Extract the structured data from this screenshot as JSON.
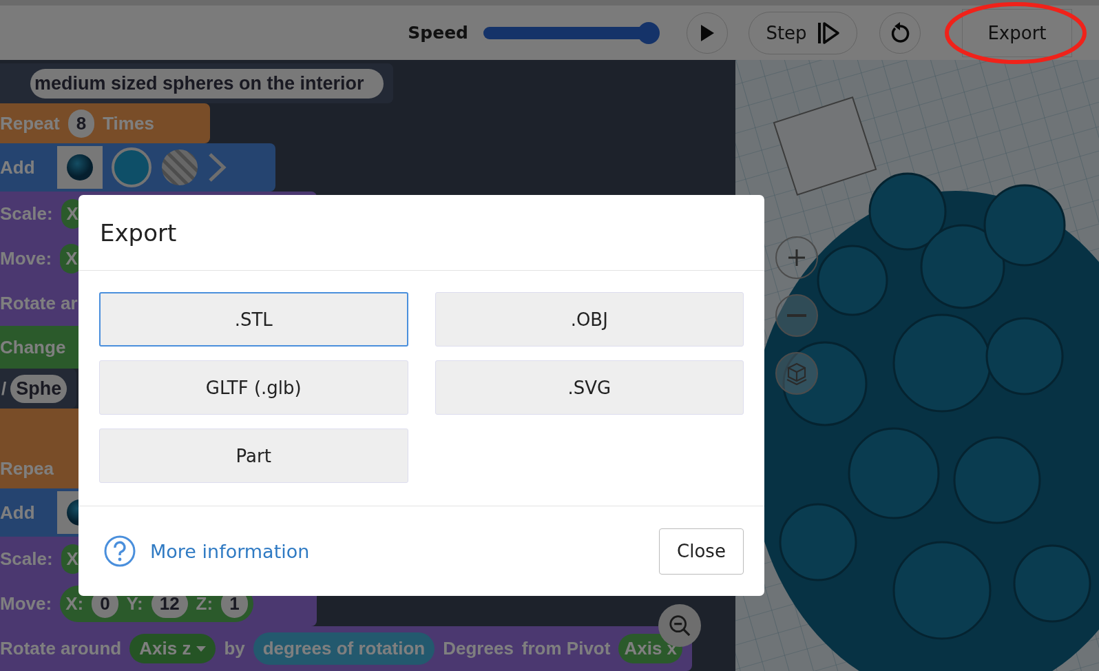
{
  "toolbar": {
    "speed_label": "Speed",
    "speed": {
      "level": 0.94
    },
    "buttons": [
      {
        "kind": "play"
      },
      {
        "kind": "step",
        "label": "Step"
      },
      {
        "kind": "reset"
      },
      {
        "kind": "export",
        "label": "Export",
        "highlighted": true
      }
    ]
  },
  "workspace": {
    "rows": [
      {
        "kind": "comment",
        "items": [
          {
            "kind": "pill",
            "text": "medium sized spheres on the interior"
          }
        ]
      },
      {
        "kind": "control",
        "items": [
          {
            "kind": "label",
            "text": "Repeat"
          },
          {
            "kind": "pill",
            "text": "8"
          },
          {
            "kind": "label",
            "text": "Times"
          }
        ]
      },
      {
        "kind": "shape",
        "items": [
          {
            "kind": "label",
            "text": "Add"
          },
          {
            "kind": "thumbnail"
          },
          {
            "kind": "color-swatch"
          },
          {
            "kind": "pattern-swatch"
          },
          {
            "kind": "chevron"
          }
        ]
      },
      {
        "kind": "transform",
        "items": [
          {
            "kind": "label",
            "text": "Scale:"
          },
          {
            "kind": "group",
            "items": [
              {
                "kind": "label",
                "text": "X"
              }
            ]
          }
        ]
      },
      {
        "kind": "transform",
        "items": [
          {
            "kind": "label",
            "text": "Move:"
          },
          {
            "kind": "group",
            "items": [
              {
                "kind": "label",
                "text": "X"
              }
            ]
          }
        ]
      },
      {
        "kind": "transform",
        "items": [
          {
            "kind": "label",
            "text": "Rotate ar"
          }
        ]
      },
      {
        "kind": "style",
        "items": [
          {
            "kind": "label",
            "text": "Change"
          }
        ]
      },
      {
        "kind": "comment",
        "items": [
          {
            "kind": "label",
            "text": "/"
          },
          {
            "kind": "pill",
            "text": "Sphe"
          }
        ]
      },
      {
        "kind": "control"
      },
      {
        "kind": "control",
        "items": [
          {
            "kind": "label",
            "text": "Repea"
          }
        ]
      },
      {
        "kind": "shape",
        "items": [
          {
            "kind": "label",
            "text": "Add"
          },
          {
            "kind": "thumbnail"
          }
        ]
      },
      {
        "kind": "transform",
        "items": [
          {
            "kind": "label",
            "text": "Scale:"
          },
          {
            "kind": "group",
            "items": [
              {
                "kind": "label",
                "text": "X"
              }
            ]
          }
        ]
      },
      {
        "kind": "transform",
        "items": [
          {
            "kind": "label",
            "text": "Move:"
          },
          {
            "kind": "group",
            "items": [
              {
                "kind": "label",
                "text": "X:"
              },
              {
                "kind": "pill",
                "text": "0"
              },
              {
                "kind": "label",
                "text": "Y:"
              },
              {
                "kind": "pill",
                "text": "12"
              },
              {
                "kind": "label",
                "text": "Z:"
              },
              {
                "kind": "pill",
                "text": "1"
              }
            ]
          }
        ]
      },
      {
        "kind": "transform",
        "items": [
          {
            "kind": "label",
            "text": "Rotate around"
          },
          {
            "kind": "dropdown",
            "text": "Axis z"
          },
          {
            "kind": "label",
            "text": "by"
          },
          {
            "kind": "variable",
            "text": "degrees of rotation"
          },
          {
            "kind": "label",
            "text": "Degrees"
          },
          {
            "kind": "label",
            "text": "from Pivot"
          },
          {
            "kind": "group",
            "items": [
              {
                "kind": "label",
                "text": "Axis x"
              }
            ]
          }
        ]
      }
    ],
    "canvas_controls": [
      {
        "kind": "zoom-out"
      }
    ]
  },
  "viewport": {
    "kind": "picture",
    "controls": [
      {
        "kind": "zoom-in"
      },
      {
        "kind": "zoom-out"
      },
      {
        "kind": "home"
      }
    ]
  },
  "dialog": {
    "title": "Export",
    "options": [
      {
        "label": ".STL",
        "selected": true
      },
      {
        "label": ".OBJ",
        "selected": false
      },
      {
        "label": "GLTF (.glb)",
        "selected": false
      },
      {
        "label": ".SVG",
        "selected": false
      },
      {
        "label": "Part",
        "selected": false
      }
    ],
    "link": "More information",
    "close": "Close"
  }
}
